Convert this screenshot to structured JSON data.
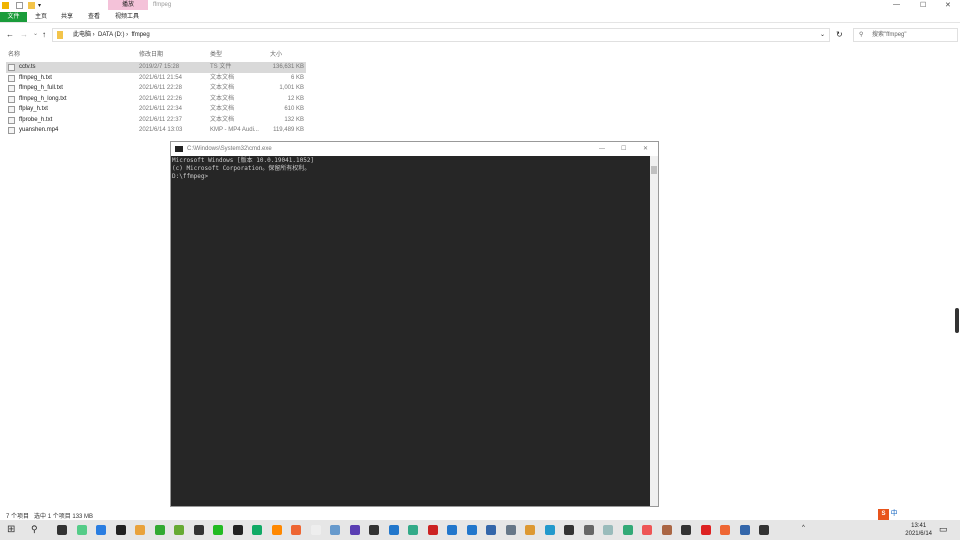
{
  "window": {
    "title": "ffmpeg",
    "context_tab": "播放",
    "controls": [
      "—",
      "☐",
      "✕"
    ]
  },
  "ribbon": {
    "tabs": [
      "文件",
      "主页",
      "共享",
      "查看",
      "视频工具"
    ]
  },
  "address": {
    "path": [
      "此电脑",
      "DATA (D:)",
      "ffmpeg"
    ],
    "search_placeholder": "搜索\"ffmpeg\""
  },
  "columns": [
    "名称",
    "修改日期",
    "类型",
    "大小"
  ],
  "files": [
    {
      "name": "cctv.ts",
      "date": "2019/2/7 15:28",
      "type": "TS 文件",
      "size": "136,631 KB",
      "selected": true
    },
    {
      "name": "ffmpeg_h.txt",
      "date": "2021/6/11 21:54",
      "type": "文本文档",
      "size": "6 KB"
    },
    {
      "name": "ffmpeg_h_full.txt",
      "date": "2021/6/11 22:28",
      "type": "文本文档",
      "size": "1,001 KB"
    },
    {
      "name": "ffmpeg_h_long.txt",
      "date": "2021/6/11 22:26",
      "type": "文本文档",
      "size": "12 KB"
    },
    {
      "name": "ffplay_h.txt",
      "date": "2021/6/11 22:34",
      "type": "文本文档",
      "size": "610 KB"
    },
    {
      "name": "ffprobe_h.txt",
      "date": "2021/6/11 22:37",
      "type": "文本文档",
      "size": "132 KB"
    },
    {
      "name": "yuanshen.mp4",
      "date": "2021/6/14 13:03",
      "type": "KMP - MP4 Audi...",
      "size": "119,489 KB"
    }
  ],
  "status": {
    "count": "7 个项目",
    "selection": "选中 1 个项目  133 MB"
  },
  "cmd": {
    "title": "C:\\Windows\\System32\\cmd.exe",
    "lines": [
      "Microsoft Windows [版本 10.0.19041.1052]",
      "(c) Microsoft Corporation。保留所有权利。",
      "",
      "D:\\ffmpeg>"
    ]
  },
  "tray": {
    "time": "13:41",
    "date": "2021/6/14",
    "ime": "中"
  },
  "taskbar_colors": [
    "#333",
    "#5c8",
    "#2a7de1",
    "#222",
    "#e9a23b",
    "#3a3",
    "#6a3",
    "#333",
    "#2b2",
    "#222",
    "#1a6",
    "#f80",
    "#e63",
    "#eee",
    "#69c",
    "#5b3fb3",
    "#333",
    "#27c",
    "#3a8",
    "#c22",
    "#27c",
    "#27c",
    "#36a",
    "#678",
    "#d93",
    "#29c",
    "#333",
    "#666",
    "#9bb",
    "#3a7",
    "#e55",
    "#a64",
    "#333",
    "#d22",
    "#e63",
    "#36a",
    "#333"
  ]
}
